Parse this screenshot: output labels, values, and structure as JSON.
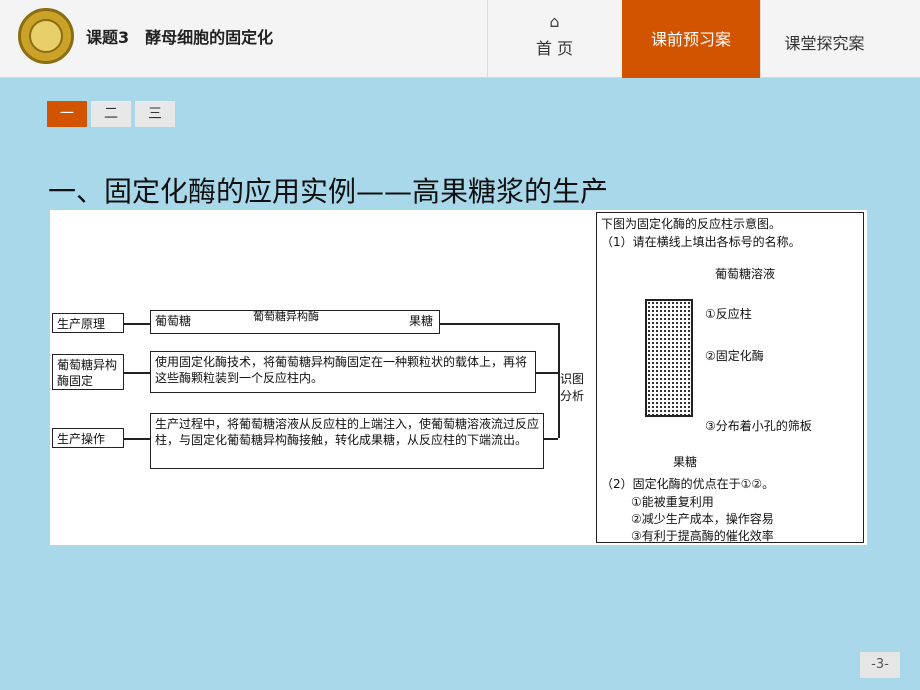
{
  "header": {
    "lesson_title": "课题3　酵母细胞的固定化",
    "nav_home": "首  页",
    "nav_preview": "课前预习案",
    "nav_class": "课堂探究案"
  },
  "tabs": [
    "一",
    "二",
    "三"
  ],
  "heading": "一、固定化酶的应用实例——高果糖浆的生产",
  "diagram": {
    "row1_label": "生产原理",
    "row1_from": "葡萄糖",
    "row1_enzyme": "葡萄糖异构酶",
    "row1_to": "果糖",
    "row2_label": "葡萄糖异构酶固定",
    "row2_text": "使用固定化酶技术，将葡萄糖异构酶固定在一种颗粒状的载体上，再将这些酶颗粒装到一个反应柱内。",
    "row3_label": "生产操作",
    "row3_text": "生产过程中，将葡萄糖溶液从反应柱的上端注入，使葡萄糖溶液流过反应柱，与固定化葡萄糖异构酶接触，转化成果糖，从反应柱的下端流出。",
    "connector": "识图分析",
    "right_intro": "下图为固定化酶的反应柱示意图。",
    "right_q1": "（1）请在横线上填出各标号的名称。",
    "col_top": "葡萄糖溶液",
    "col_1": "①反应柱",
    "col_2": "②固定化酶",
    "col_3": "③分布着小孔的筛板",
    "col_bottom": "果糖",
    "q2": "（2）固定化酶的优点在于①②。",
    "adv1": "①能被重复利用",
    "adv2": "②减少生产成本，操作容易",
    "adv3": "③有利于提高酶的催化效率"
  },
  "page_number": "-3-"
}
